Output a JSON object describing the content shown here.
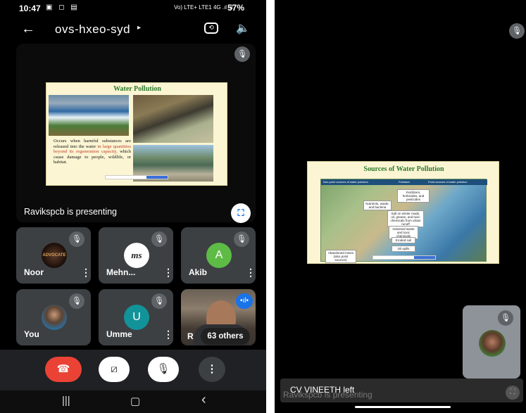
{
  "status_bar": {
    "time": "10:47",
    "notification_icons": "▣ ◻ ▤",
    "signal_text": "Vo) LTE+ LTE1 4G .ıl .ıl",
    "battery": "57%"
  },
  "meeting": {
    "title": "ovs-hxeo-syd",
    "title_caret": "▸",
    "back_icon": "←",
    "speaker_icon": "🔈"
  },
  "presentation": {
    "slide_title": "Water Pollution",
    "slide_text_1": "Occurs when harmful substances are released into the water",
    "slide_text_highlight": "in large quantities beyond its regeneration capacity,",
    "slide_text_2": "which cause damage to people, wildlife, or habitat.",
    "presenter_label": "Ravikspcb is presenting",
    "fullscreen_icon": "⛶"
  },
  "participants": [
    {
      "name": "Noor",
      "avatar_text": "ADVOCATE"
    },
    {
      "name": "Mehn...",
      "avatar_text": "ms"
    },
    {
      "name": "Akib",
      "avatar_text": "A"
    },
    {
      "name": "You",
      "avatar_text": ""
    },
    {
      "name": "Umme",
      "avatar_text": "U"
    }
  ],
  "video_tile": {
    "name_initial": "R",
    "others_label": "63 others",
    "speaking_icon": "•ıl•"
  },
  "icons": {
    "mic_off": "🎙",
    "more_vert": "⋮",
    "end_call": "☎",
    "camera_off": "⧄",
    "more": "⋮"
  },
  "nav": {
    "recents": "|||",
    "home": "▢",
    "back": "‹"
  },
  "right_screen": {
    "slide_title": "Sources of Water Pollution",
    "diagram_headers": [
      "Non-point sources of water pollution",
      "Pollutant",
      "Point sources of water pollution"
    ],
    "diagram_labels": [
      "Fertilizers, herbicides, and pesticides",
      "Nutrients, waste, and bacteria",
      "Salt on winter roads, oil, grease, and toxic chemicals from urban runoff",
      "Industrial waste and toxic chemicals",
      "Eroded soil",
      "Oil spills",
      "Abandoned mines (also point sources)"
    ],
    "toast_message": "CV VINEETH left",
    "ghost_presenting": "Ravikspcb is presenting"
  },
  "colors": {
    "end_call": "#ea4335",
    "accent_blue": "#1a73e8",
    "tile_bg": "#3c4043",
    "akib_green": "#5dbb46",
    "umme_teal": "#12939a"
  }
}
